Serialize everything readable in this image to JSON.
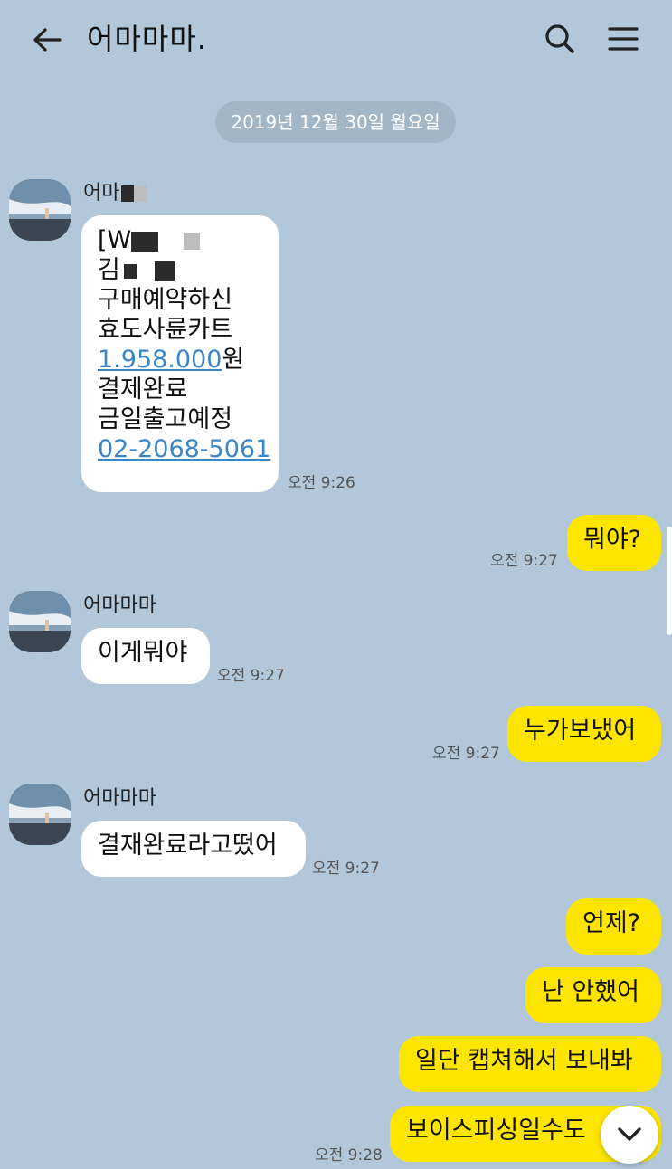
{
  "header": {
    "back_icon": "arrow-left-icon",
    "title": "어마마마.",
    "search_icon": "search-icon",
    "menu_icon": "hamburger-menu-icon"
  },
  "date_divider": "2019년 12월 30일 월요일",
  "colors": {
    "background": "#b2c7da",
    "incoming_bubble": "#ffffff",
    "outgoing_bubble": "#fee500",
    "link": "#3a86c8"
  },
  "messages": [
    {
      "direction": "in",
      "sender": "어마",
      "lines": [
        "[W",
        "김",
        "구매예약하신",
        "효도사륜카트",
        "1.958.000",
        "원",
        "결제완료",
        "금일출고예정",
        "02-2068-5061"
      ],
      "time": "오전 9:26"
    },
    {
      "direction": "out",
      "text": "뭐야?",
      "time": "오전 9:27"
    },
    {
      "direction": "in",
      "sender": "어마마마",
      "text": "이게뭐야",
      "time": "오전 9:27"
    },
    {
      "direction": "out",
      "text": "누가보냈어",
      "time": "오전 9:27"
    },
    {
      "direction": "in",
      "sender": "어마마마",
      "text": "결재완료라고떴어",
      "time": "오전 9:27"
    },
    {
      "direction": "out",
      "text": "언제?"
    },
    {
      "direction": "out",
      "text": "난 안했어"
    },
    {
      "direction": "out",
      "text": "일단 캡쳐해서 보내봐"
    },
    {
      "direction": "out",
      "text": "보이스피싱일수도",
      "time": "오전 9:28"
    }
  ],
  "scroll_down_icon": "chevron-down-icon"
}
